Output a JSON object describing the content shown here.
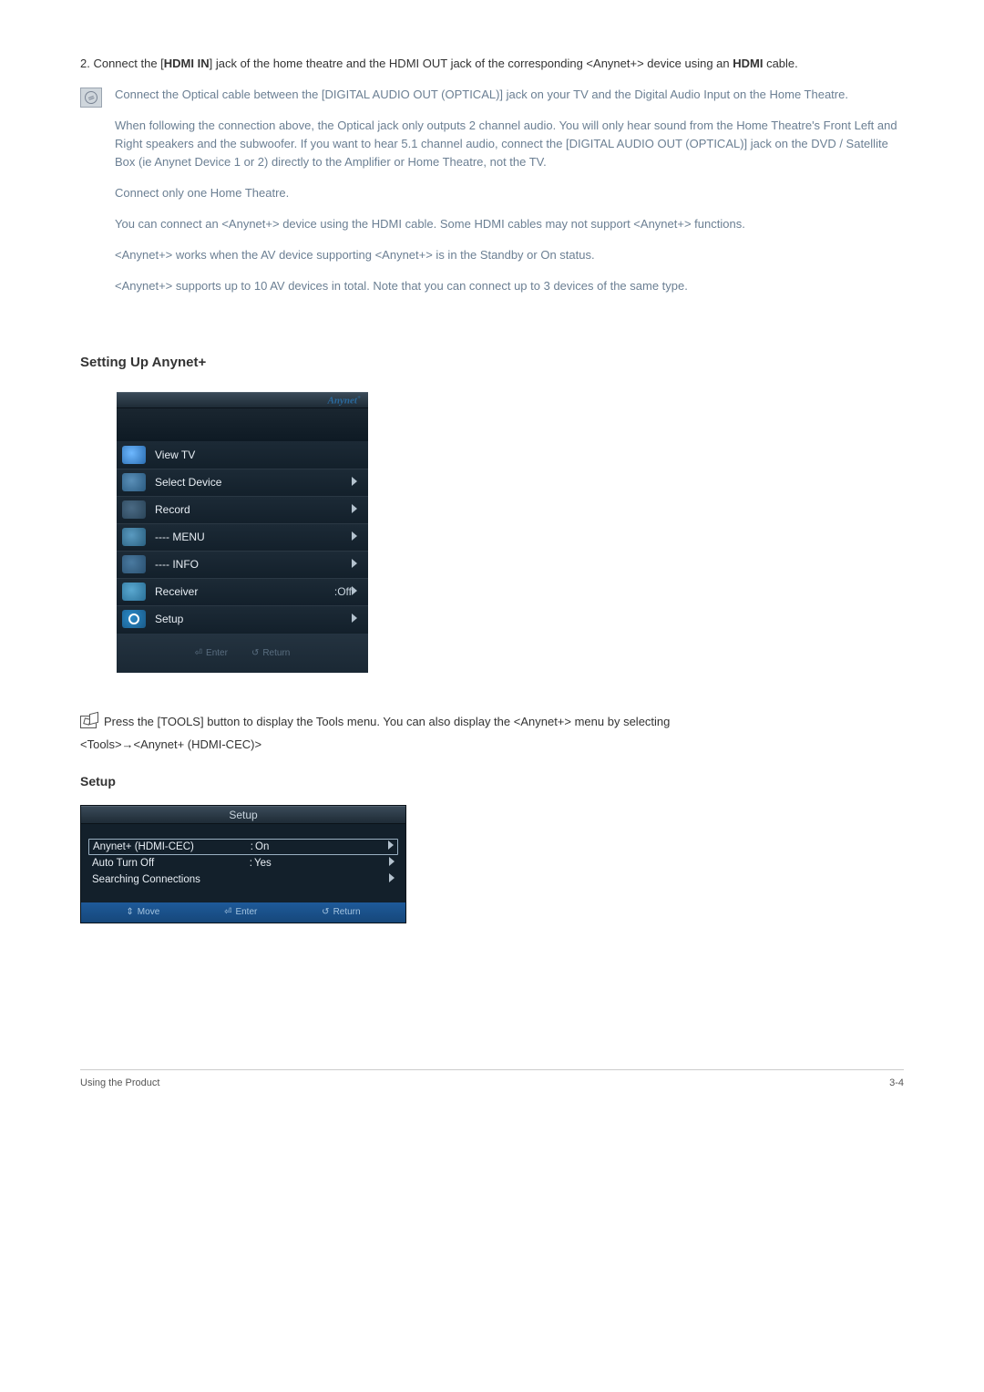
{
  "intro": {
    "step2_prefix": "2. Connect the [",
    "step2_bold1": "HDMI IN",
    "step2_mid": "] jack of the home theatre and the HDMI OUT jack of the corresponding <Anynet+> device using an ",
    "step2_bold2": "HDMI",
    "step2_suffix": " cable."
  },
  "notes": [
    "Connect the Optical cable between the [DIGITAL AUDIO OUT (OPTICAL)] jack on your TV and the Digital Audio Input on the Home Theatre.",
    "When following the connection above, the Optical jack only outputs 2 channel audio. You will only hear sound from the Home Theatre's Front Left and Right speakers and the subwoofer. If you want to hear 5.1 channel audio, connect the [DIGITAL AUDIO OUT (OPTICAL)] jack on the DVD / Satellite Box (ie Anynet Device 1 or 2) directly to the Amplifier or Home Theatre, not the TV.",
    "Connect only one Home Theatre.",
    "You can connect an <Anynet+> device using the HDMI cable. Some HDMI cables may not support <Anynet+> functions.",
    "<Anynet+> works when the AV device supporting <Anynet+> is in the Standby or On status.",
    "<Anynet+> supports up to 10 AV devices in total. Note that you can connect up to 3 devices of the same type."
  ],
  "section_heading": "Setting Up Anynet+",
  "anynet_menu": {
    "logo": "Anynet",
    "logo_plus": "+",
    "items": [
      {
        "label": "View TV",
        "icon": "tv",
        "arrow": false
      },
      {
        "label": "Select Device",
        "icon": "dev",
        "arrow": true
      },
      {
        "label": "Record",
        "icon": "rec",
        "arrow": true
      },
      {
        "label": "---- MENU",
        "icon": "menu",
        "arrow": true
      },
      {
        "label": "---- INFO",
        "icon": "info",
        "arrow": true
      },
      {
        "label": "Receiver",
        "sub": ":Off",
        "icon": "recv",
        "arrow": true
      },
      {
        "label": "Setup",
        "icon": "setup",
        "arrow": true
      }
    ],
    "footer": {
      "enter": "Enter",
      "return": "Return"
    }
  },
  "tools_line": "Press the [TOOLS] button to display the Tools menu. You can also display the <Anynet+> menu by selecting",
  "tools_path": "<Tools>→<Anynet+ (HDMI-CEC)>",
  "setup_heading": "Setup",
  "setup_menu": {
    "title": "Setup",
    "rows": [
      {
        "label": "Anynet+ (HDMI-CEC)",
        "value": "On",
        "selected": true,
        "arrow": true
      },
      {
        "label": "Auto Turn Off",
        "value": "Yes",
        "selected": false,
        "arrow": true
      },
      {
        "label": "Searching Connections",
        "value": "",
        "selected": false,
        "arrow": true
      }
    ],
    "footer": {
      "move": "Move",
      "enter": "Enter",
      "return": "Return"
    }
  },
  "footer": {
    "left": "Using the Product",
    "right": "3-4"
  }
}
